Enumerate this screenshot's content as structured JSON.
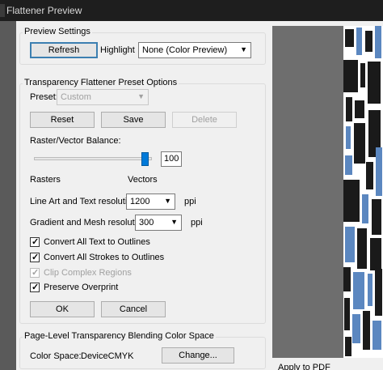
{
  "window": {
    "title": "Flattener Preview"
  },
  "preview_settings": {
    "title": "Preview Settings",
    "refresh_label": "Refresh",
    "highlight_label": "Highlight",
    "highlight_value": "None (Color Preview)"
  },
  "preset_options": {
    "title": "Transparency Flattener Preset Options",
    "preset_label": "Preset:",
    "preset_value": "Custom",
    "reset_label": "Reset",
    "save_label": "Save",
    "delete_label": "Delete",
    "balance_label": "Raster/Vector Balance:",
    "balance_value": "100",
    "rasters_label": "Rasters",
    "vectors_label": "Vectors",
    "line_art_label": "Line Art and Text resolution:",
    "line_art_value": "1200",
    "line_art_unit": "ppi",
    "gradient_label": "Gradient and Mesh resolution:",
    "gradient_value": "300",
    "gradient_unit": "ppi",
    "checkboxes": [
      {
        "label": "Convert All Text to Outlines",
        "checked": true,
        "disabled": false
      },
      {
        "label": "Convert All Strokes to Outlines",
        "checked": true,
        "disabled": false
      },
      {
        "label": "Clip Complex Regions",
        "checked": true,
        "disabled": true
      },
      {
        "label": "Preserve Overprint",
        "checked": true,
        "disabled": false
      }
    ],
    "ok_label": "OK",
    "cancel_label": "Cancel"
  },
  "color_space": {
    "title": "Page-Level Transparency Blending Color Space",
    "label": "Color Space:",
    "value": "DeviceCMYK",
    "change_label": "Change..."
  },
  "preview_panel": {
    "apply_label": "Apply to PDF"
  },
  "colors": {
    "accent": "#3c7fb1",
    "slider": "#007ad9",
    "preview_blue": "#5b87c0",
    "preview_gray": "#6e6e6e"
  }
}
